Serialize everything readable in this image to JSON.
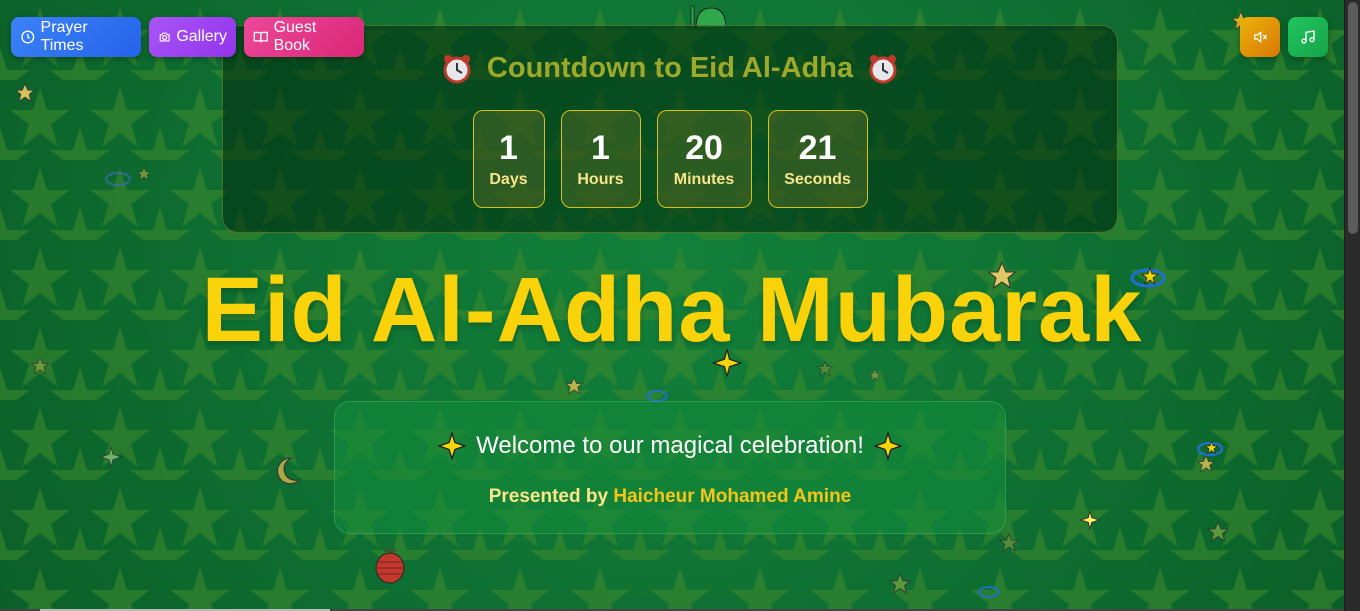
{
  "nav": {
    "prayer_label": "Prayer Times",
    "gallery_label": "Gallery",
    "guestbook_label": "Guest Book"
  },
  "controls": {
    "mute_icon": "volume-mute-icon",
    "music_icon": "music-note-icon"
  },
  "countdown": {
    "title": "Countdown to Eid Al-Adha",
    "units": [
      {
        "value": "1",
        "label": "Days"
      },
      {
        "value": "1",
        "label": "Hours"
      },
      {
        "value": "20",
        "label": "Minutes"
      },
      {
        "value": "21",
        "label": "Seconds"
      }
    ]
  },
  "headline": "Eid Al-Adha Mubarak",
  "welcome": {
    "message": "Welcome to our magical celebration!",
    "presented_by": "Presented by",
    "presenter_name": "Haicheur Mohamed Amine"
  },
  "colors": {
    "background": "#0f7334",
    "headline": "#f9d20a",
    "prayer_button": "#2563eb",
    "gallery_button": "#9333ea",
    "guestbook_button": "#db2777",
    "mute_button": "#d97706",
    "music_button": "#16a34a"
  }
}
